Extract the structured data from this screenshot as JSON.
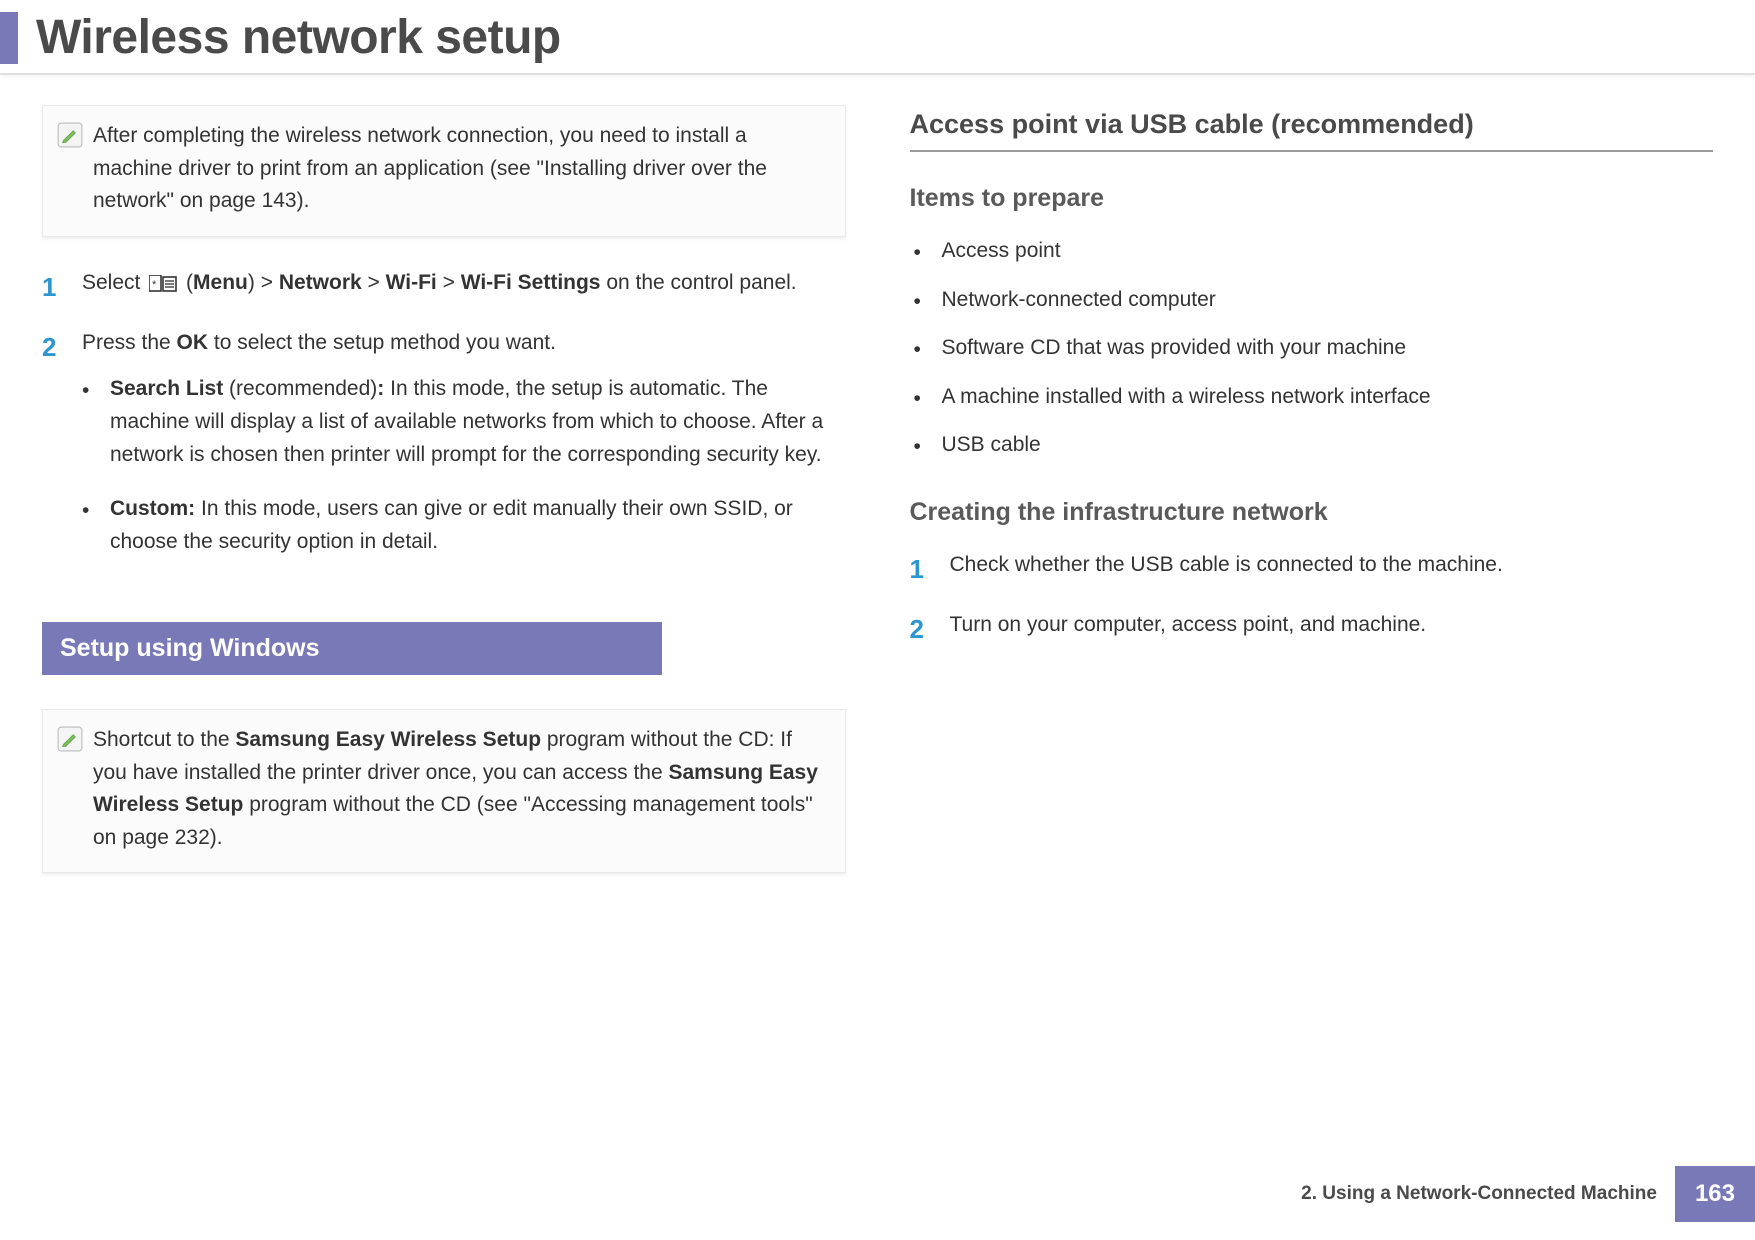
{
  "title": "Wireless network setup",
  "left": {
    "note1": "After completing the wireless network connection, you need to install a machine driver to print from an application (see \"Installing driver over the network\" on page 143).",
    "steps": [
      {
        "num": "1",
        "pre": "Select ",
        "menu_open": " (",
        "menu": "Menu",
        "menu_close": ") > ",
        "p2": "Network",
        "sep1": " > ",
        "p3": "Wi-Fi",
        "sep2": " > ",
        "p4": "Wi-Fi Settings",
        "tail": " on the control panel."
      },
      {
        "num": "2",
        "pre": "Press the ",
        "bold": "OK",
        "tail": " to select the setup method you want.",
        "sub": [
          {
            "b1": "Search List",
            "mid": " (recommended)",
            "b2": ":",
            "rest": " In this mode, the setup is automatic. The machine will display a list of available networks from which to choose. After a network is chosen then printer will prompt for the corresponding security key."
          },
          {
            "b1": "Custom:",
            "rest": " In this mode, users can give or edit manually their own SSID, or choose the security option in detail."
          }
        ]
      }
    ],
    "band": "Setup using Windows",
    "note2_pre": "Shortcut to the ",
    "note2_b1": "Samsung Easy Wireless Setup",
    "note2_mid": " program without the CD: If you have installed the printer driver once, you can access the ",
    "note2_b2": "Samsung Easy Wireless Setup",
    "note2_tail": " program without the CD (see \"Accessing management tools\" on page 232)."
  },
  "right": {
    "h2": "Access point via USB cable (recommended)",
    "h3a": "Items to prepare",
    "items": [
      "Access point",
      "Network-connected computer",
      "Software CD that was provided with your machine",
      "A machine installed with a wireless network interface",
      "USB cable"
    ],
    "h3b": "Creating the infrastructure network",
    "steps": [
      {
        "num": "1",
        "text": "Check whether the USB cable is connected to the machine."
      },
      {
        "num": "2",
        "text": "Turn on your computer, access point, and machine."
      }
    ]
  },
  "footer": {
    "chapter": "2.  Using a Network-Connected Machine",
    "page": "163"
  }
}
